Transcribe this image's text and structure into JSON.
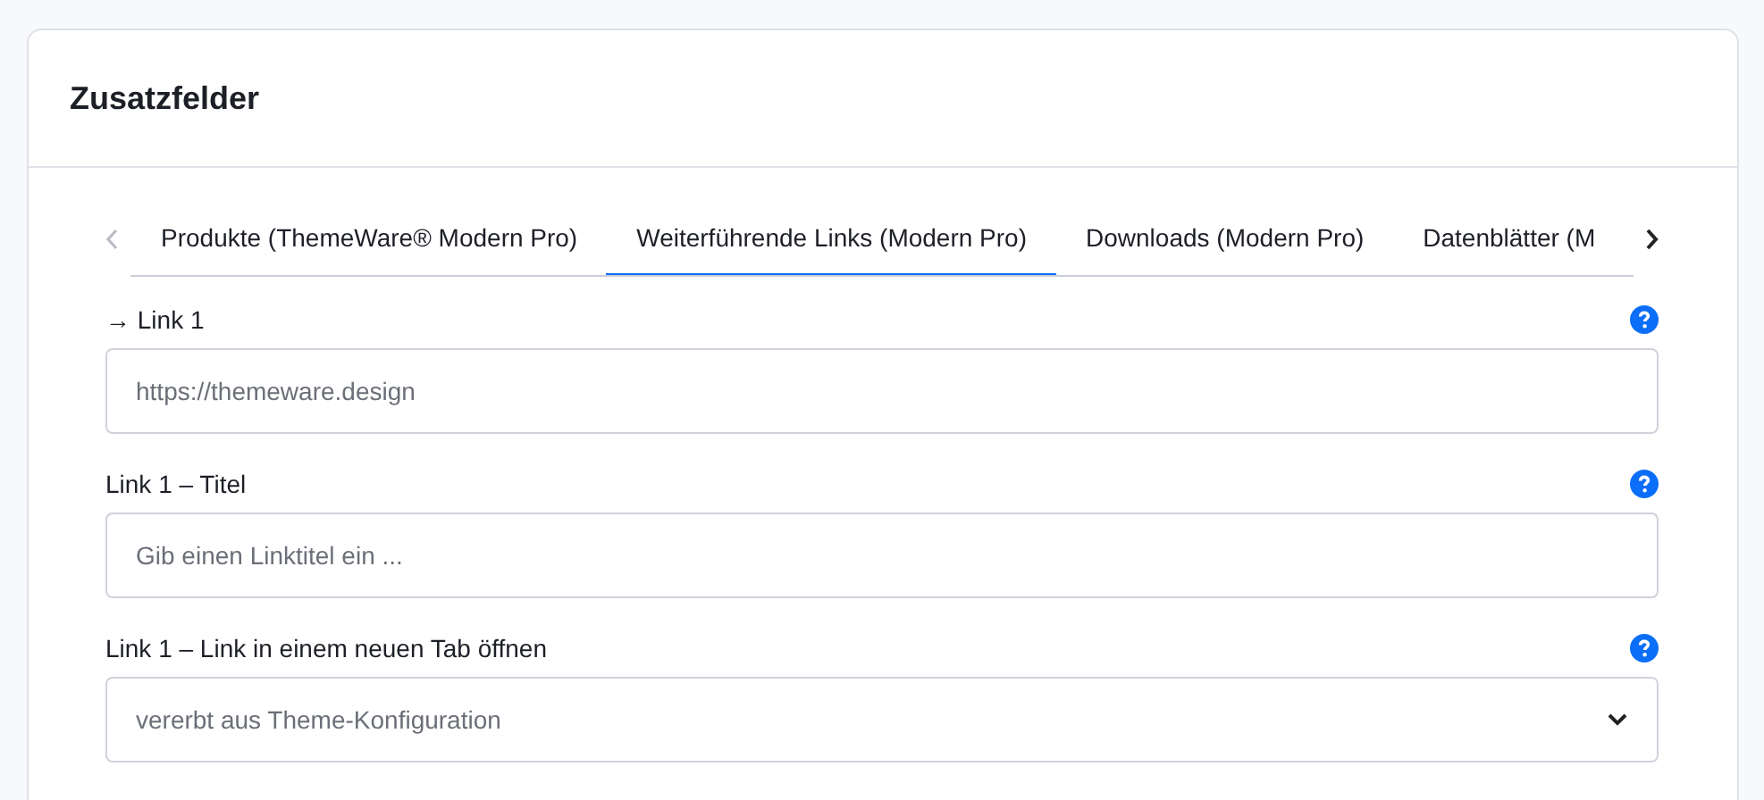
{
  "card": {
    "title": "Zusatzfelder"
  },
  "tabs": [
    {
      "label": "Produkte (ThemeWare® Modern Pro)",
      "selected": false
    },
    {
      "label": "Weiterführende Links (Modern Pro)",
      "selected": true
    },
    {
      "label": "Downloads (Modern Pro)",
      "selected": false
    },
    {
      "label": "Datenblätter (M",
      "selected": false
    }
  ],
  "fields": [
    {
      "kind": "text",
      "label": "→ Link 1",
      "placeholder": "https://themeware.design"
    },
    {
      "kind": "text",
      "label": "Link 1 – Titel",
      "placeholder": "Gib einen Linktitel ein ..."
    },
    {
      "kind": "select",
      "label": "Link 1 – Link in einem neuen Tab öffnen",
      "value": "vererbt aus Theme-Konfiguration"
    }
  ]
}
